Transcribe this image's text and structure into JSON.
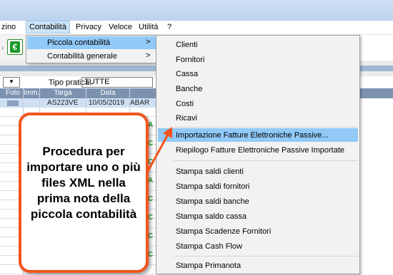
{
  "menubar": {
    "items": [
      "zino",
      "Contabilità",
      "Privacy",
      "Veloce",
      "Utilità",
      "?"
    ]
  },
  "filter": {
    "tipo_pratica_label": "Tipo pratica:",
    "tipo_pratica_value": "TUTTE"
  },
  "table": {
    "headers": [
      "Foto",
      "Imm.",
      "Targa",
      "Data"
    ],
    "first_row": {
      "targa": "AS223VE",
      "data": "10/05/2019",
      "extra": "ABAR"
    }
  },
  "submenu_contabilita": {
    "items": [
      {
        "label": "Piccola contabilità",
        "highlighted": true
      },
      {
        "label": "Contabilità generale",
        "highlighted": false
      }
    ]
  },
  "submenu_piccola": {
    "items": [
      "Clienti",
      "Fornitori",
      "Cassa",
      "Banche",
      "Costi",
      "Ricavi",
      "Importazione Fatture Elettroniche Passive...",
      "Riepilogo Fatture Elettroniche Passive Importate",
      "Stampa saldi clienti",
      "Stampa saldi fornitori",
      "Stampa saldi banche",
      "Stampa saldo cassa",
      "Stampa Scadenze Fornitori",
      "Stampa Cash Flow",
      "Stampa Primanota"
    ],
    "highlighted_index": 6
  },
  "callout": {
    "text": "Procedura per importare uno o più files XML nella prima nota della piccola contabilità"
  },
  "colors": {
    "highlight": "#91c9f7",
    "callout_border": "#f3541d",
    "status_green": "#27a827",
    "table_header": "#7c93b0"
  }
}
